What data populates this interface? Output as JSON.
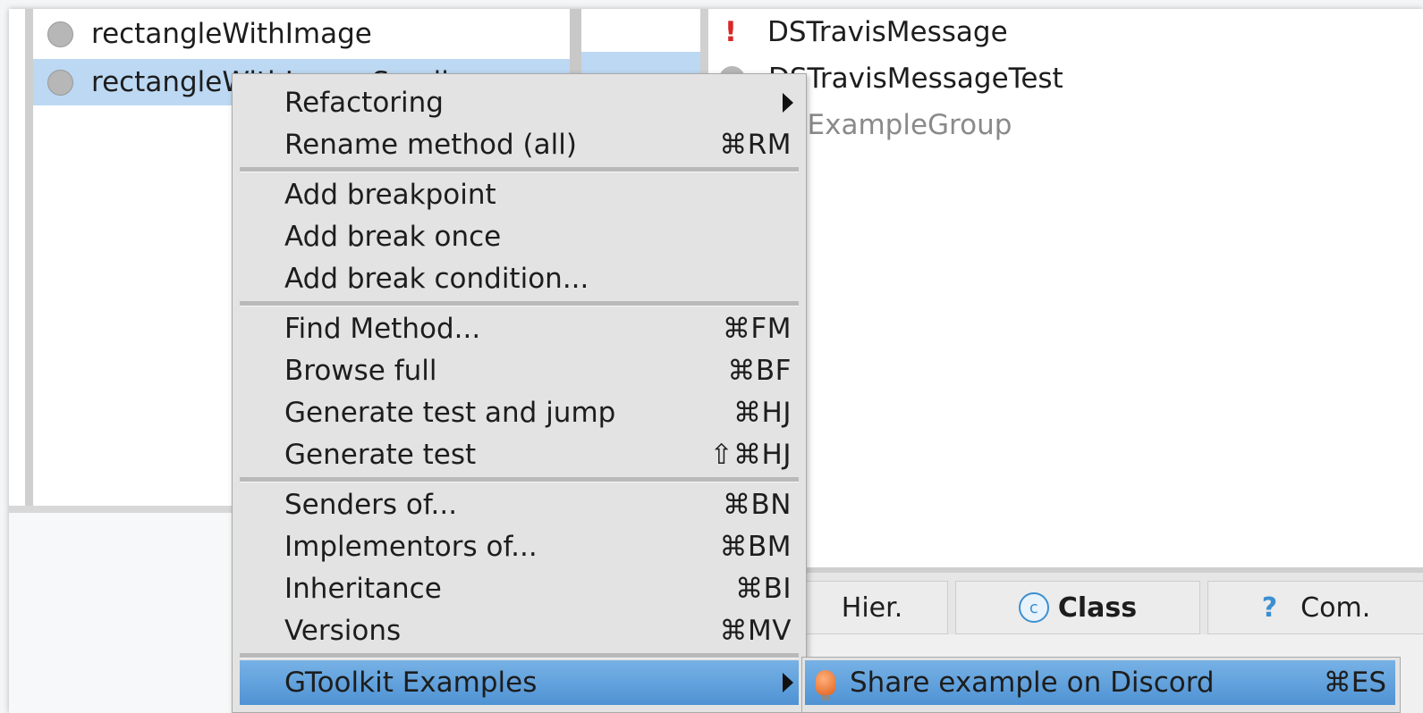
{
  "method_list": {
    "items": [
      {
        "label": "rectangleWithImage",
        "selected": false
      },
      {
        "label": "rectangleWithImageSmall",
        "selected": true
      }
    ]
  },
  "class_list": {
    "items": [
      {
        "label": "DSTravisMessage",
        "marker": "!"
      },
      {
        "label": "DSTravisMessageTest",
        "marker": "dot"
      },
      {
        "label": "DSExampleGroup",
        "marker": "dot",
        "muted": true
      }
    ]
  },
  "tabs": [
    {
      "label": "Hier.",
      "icon": ""
    },
    {
      "label": "Class",
      "icon": "class-icon",
      "icon_glyph": "c"
    },
    {
      "label": "Com.",
      "icon": "help-icon",
      "icon_glyph": "?"
    }
  ],
  "context_menu": {
    "items": [
      {
        "label": "Refactoring",
        "shortcut": "",
        "submenu": true
      },
      {
        "label": "Rename method (all)",
        "shortcut": "⌘RM"
      },
      {
        "label": "Add breakpoint",
        "shortcut": ""
      },
      {
        "label": "Add break once",
        "shortcut": ""
      },
      {
        "label": "Add break condition...",
        "shortcut": ""
      },
      {
        "label": "Find Method...",
        "shortcut": "⌘FM"
      },
      {
        "label": "Browse full",
        "shortcut": "⌘BF"
      },
      {
        "label": "Generate test and jump",
        "shortcut": "⌘HJ"
      },
      {
        "label": "Generate test",
        "shortcut": "⇧⌘HJ"
      },
      {
        "label": "Senders of...",
        "shortcut": "⌘BN"
      },
      {
        "label": "Implementors of...",
        "shortcut": "⌘BM"
      },
      {
        "label": "Inheritance",
        "shortcut": "⌘BI"
      },
      {
        "label": "Versions",
        "shortcut": "⌘MV"
      },
      {
        "label": "GToolkit Examples",
        "shortcut": "",
        "submenu": true,
        "highlighted": true
      }
    ]
  },
  "submenu": {
    "item": {
      "label": "Share example on Discord",
      "shortcut": "⌘ES",
      "icon": "lightbulb-icon"
    }
  },
  "colors": {
    "selection": "#bcd8f3",
    "menu_highlight": "#5a9bd9",
    "error_marker": "#d92626",
    "accent": "#3c8fd0"
  }
}
